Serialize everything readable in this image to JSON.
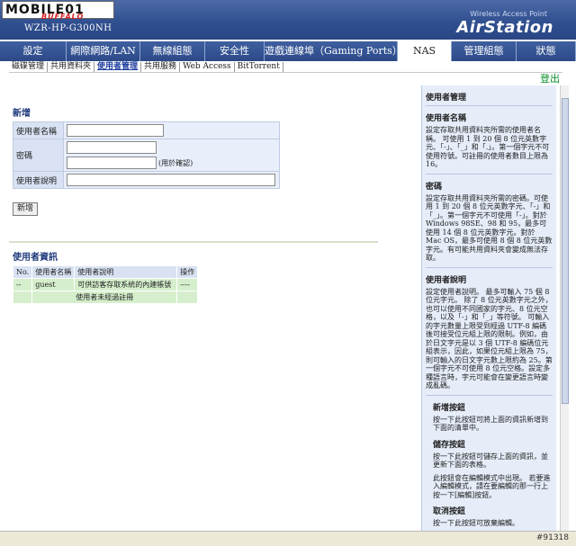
{
  "header": {
    "logo": "MOBILE01",
    "buffalo": "BUFFALO",
    "model": "WZR-HP-G300NH",
    "wap": "Wireless Access Point",
    "brand": "AirStation"
  },
  "main_tabs": [
    {
      "label": "設定",
      "w": 74
    },
    {
      "label": "網際網路/LAN",
      "w": 82
    },
    {
      "label": "無線組態",
      "w": 72
    },
    {
      "label": "安全性",
      "w": 66
    },
    {
      "label": "遊戲連線埠（Gaming Ports）",
      "w": 148
    },
    {
      "label": "NAS",
      "w": 60,
      "active": true
    },
    {
      "label": "管理組態",
      "w": 72
    },
    {
      "label": "狀態",
      "w": 66
    }
  ],
  "sub_tabs": [
    {
      "label": "磁碟管理"
    },
    {
      "label": "共用資料夾"
    },
    {
      "label": "使用者管理",
      "active": true
    },
    {
      "label": "共用服務"
    },
    {
      "label": "Web Access"
    },
    {
      "label": "BitTorrent"
    }
  ],
  "logout": "登出",
  "add_section": {
    "title": "新增",
    "username_label": "使用者名稱",
    "password_label": "密碼",
    "confirm_hint": "(用於確認)",
    "description_label": "使用者說明",
    "add_button": "新增"
  },
  "info_section": {
    "title": "使用者資訊",
    "columns": [
      "No.",
      "使用者名稱",
      "使用者說明",
      "操作"
    ],
    "rows": [
      {
        "no": "--",
        "name": "guest",
        "desc": "可供訪客存取系統的內建帳號",
        "op": "----"
      }
    ],
    "empty_note": "使用者未經過註冊"
  },
  "help": {
    "title": "使用者管理",
    "blocks": [
      {
        "h": "使用者名稱",
        "p": "設定存取共用資料夾所需的使用者名稱。 可使用 1 到 20 個 8 位元英數字元、「-」、「_」和「.」。第一個字元不可使用符號。可註冊的使用者數目上限為 16。"
      },
      {
        "h": "密碼",
        "p": "設定存取共用資料夾所需的密碼。可使用 1 到 20 個 8 位元英數字元、「-」和「_」。第一個字元不可使用「-」。對於 Windows 98SE、98 和 95，最多可使用 14 個 8 位元英數字元。對於 Mac OS，最多可使用 8 個 8 位元英數字元。有可能共用資料夾會變成無法存取。"
      },
      {
        "h": "使用者說明",
        "p": "設定使用者說明。 最多可輸入 75 個 8 位元字元。 除了 8 位元英數字元之外，也可以使用不同國家的字元、8 位元空格，以及「-」和「_」等符號。 可輸入的字元數量上限受到經過 UTF-8 編碼後可接受位元組上限的限制。例如，由於日文字元是以 3 個 UTF-8 編碼位元組表示，因此，如果位元組上限為 75，則可輸入的日文字元數上限約為 25。第一個字元不可使用 8 位元空格。設定多種語言時，字元可能會在變更語言時變成亂碼。"
      }
    ],
    "sub_blocks": [
      {
        "h": "新增按鈕",
        "p": "按一下此按鈕可將上面的資訊新增到下面的清單中。"
      },
      {
        "h": "儲存按鈕",
        "p": "按一下此按鈕可儲存上面的資訊，並更新下面的表格。"
      },
      {
        "h": "",
        "p": "此按鈕會在編輯模式中出現。 若要進入編輯模式，請在要編輯的那一行上按一下[編輯]按鈕。"
      },
      {
        "h": "取消按鈕",
        "p": "按一下此按鈕可放棄編輯。"
      }
    ]
  },
  "watermark": "#91318"
}
